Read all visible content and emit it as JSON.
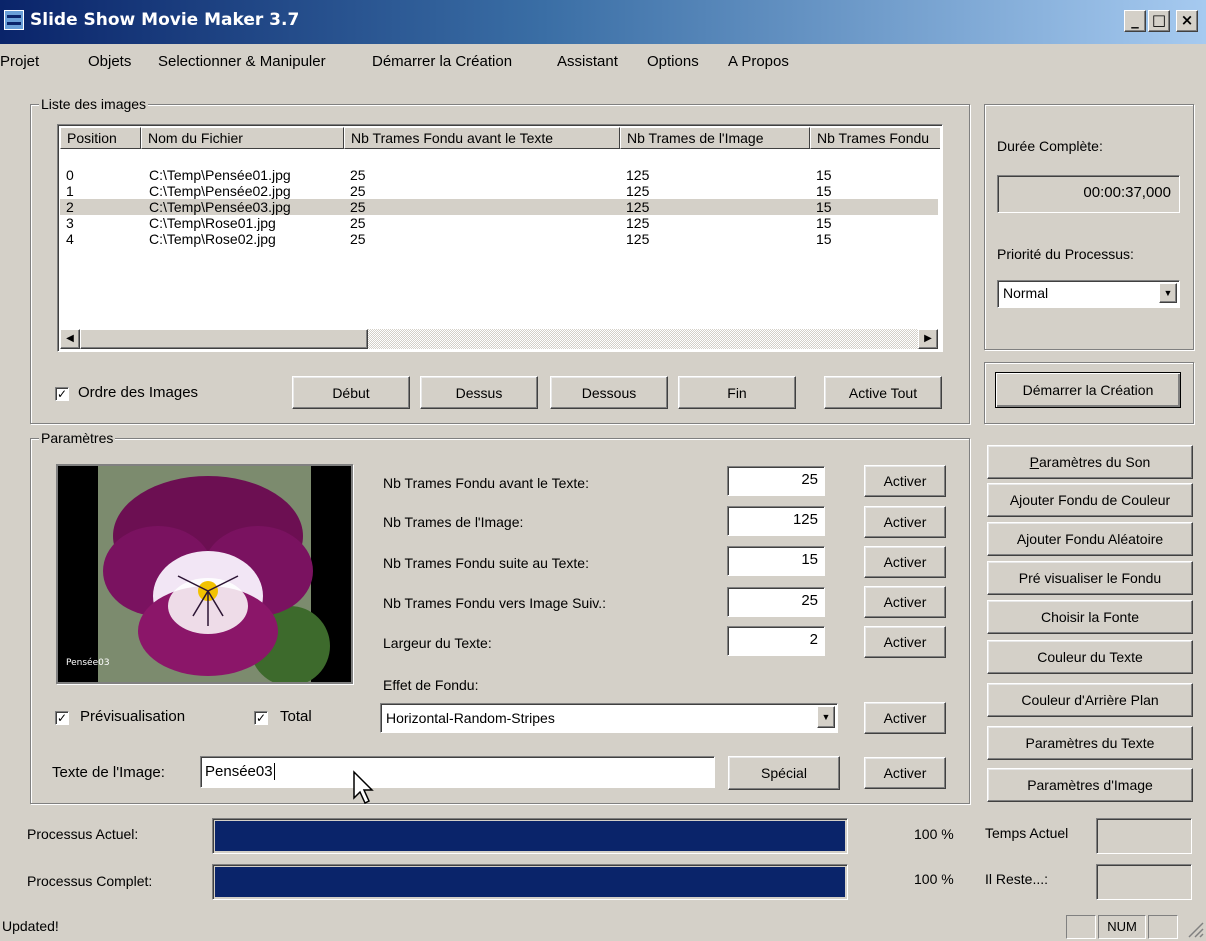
{
  "window": {
    "title": "Slide Show Movie Maker 3.7",
    "minimize": "_",
    "maximize": "□",
    "close": "×"
  },
  "menu": [
    "Projet",
    "Objets",
    "Selectionner & Manipuler",
    "Démarrer la Création",
    "Assistant",
    "Options",
    "A Propos"
  ],
  "image_list": {
    "group_label": "Liste des images",
    "columns": [
      "Position",
      "Nom du Fichier",
      "Nb Trames Fondu avant le Texte",
      "Nb Trames de l'Image",
      "Nb Trames Fondu"
    ],
    "rows": [
      [
        "0",
        "C:\\Temp\\Pensée01.jpg",
        "25",
        "125",
        "15"
      ],
      [
        "1",
        "C:\\Temp\\Pensée02.jpg",
        "25",
        "125",
        "15"
      ],
      [
        "2",
        "C:\\Temp\\Pensée03.jpg",
        "25",
        "125",
        "15"
      ],
      [
        "3",
        "C:\\Temp\\Rose01.jpg",
        "25",
        "125",
        "15"
      ],
      [
        "4",
        "C:\\Temp\\Rose02.jpg",
        "25",
        "125",
        "15"
      ]
    ],
    "selected_row": 2,
    "order_label": "Ordre des Images",
    "order_checked": true,
    "buttons": {
      "start": "Début",
      "up": "Dessus",
      "down": "Dessous",
      "end": "Fin",
      "activate_all": "Active Tout"
    }
  },
  "side": {
    "duration_label": "Durée Complète:",
    "duration_value": "00:00:37,000",
    "priority_label": "Priorité du Processus:",
    "priority_value": "Normal",
    "start_creation": "Démarrer la Création",
    "buttons": [
      "Paramètres du Son",
      "Ajouter Fondu de Couleur",
      "Ajouter Fondu Aléatoire",
      "Pré visualiser le Fondu",
      "Choisir la Fonte",
      "Couleur du Texte",
      "Couleur d'Arrière Plan",
      "Paramètres du Texte",
      "Paramètres d'Image"
    ]
  },
  "params": {
    "group_label": "Paramètres",
    "preview_caption": "Pensée03",
    "fields": [
      {
        "label": "Nb Trames Fondu avant le Texte:",
        "value": "25"
      },
      {
        "label": "Nb Trames de l'Image:",
        "value": "125"
      },
      {
        "label": "Nb Trames Fondu suite au Texte:",
        "value": "15"
      },
      {
        "label": "Nb Trames Fondu vers Image Suiv.:",
        "value": "25"
      },
      {
        "label": "Largeur du Texte:",
        "value": "2"
      }
    ],
    "activate_label": "Activer",
    "effect_label": "Effet de Fondu:",
    "effect_value": "Horizontal-Random-Stripes",
    "preview_label": "Prévisualisation",
    "preview_checked": true,
    "total_label": "Total",
    "total_checked": true,
    "text_label": "Texte de l'Image:",
    "text_value": "Pensée03",
    "special_label": "Spécial"
  },
  "progress": {
    "current_label": "Processus Actuel:",
    "current_percent": 100,
    "current_text": "100 %",
    "complete_label": "Processus Complet:",
    "complete_percent": 100,
    "complete_text": "100 %",
    "time_label": "Temps Actuel",
    "remaining_label": "Il Reste...:"
  },
  "status": {
    "message": "Updated!",
    "num": "NUM"
  }
}
